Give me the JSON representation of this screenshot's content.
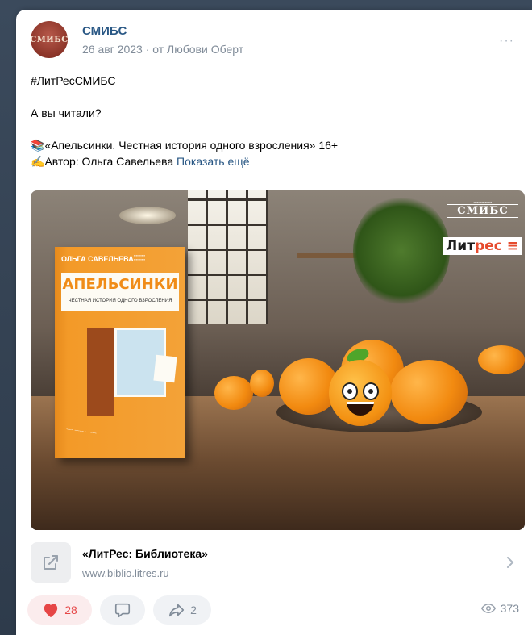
{
  "post": {
    "author_name": "СМИБС",
    "avatar_text": "СМИБС",
    "date": "26 авг 2023",
    "separator": " · ",
    "from": "от Любови Оберт",
    "more": "···",
    "hashtag": "#ЛитРесСМИБС",
    "question": "А вы читали?",
    "book_line": "«Апельсинки. Честная история одного взросления» 16+",
    "author_line": "Автор: Ольга Савельева",
    "show_more": "Показать ещё"
  },
  "image": {
    "book_author": "ОЛЬГА САВЕЛЬЕВА",
    "book_title": "АПЕЛЬСИНКИ",
    "book_subtitle": "ЧЕСТНАЯ ИСТОРИЯ ОДНОГО ВЗРОСЛЕНИЯ",
    "logo_smibs": "СМИБС",
    "logo_litres_1": "Лит",
    "logo_litres_2": "рес"
  },
  "snippet": {
    "title": "«ЛитРес: Библиотека»",
    "url": "www.biblio.litres.ru"
  },
  "actions": {
    "likes": "28",
    "shares": "2",
    "views": "373"
  },
  "colors": {
    "link": "#2a5885",
    "like": "#e64646",
    "muted": "#818c99"
  }
}
